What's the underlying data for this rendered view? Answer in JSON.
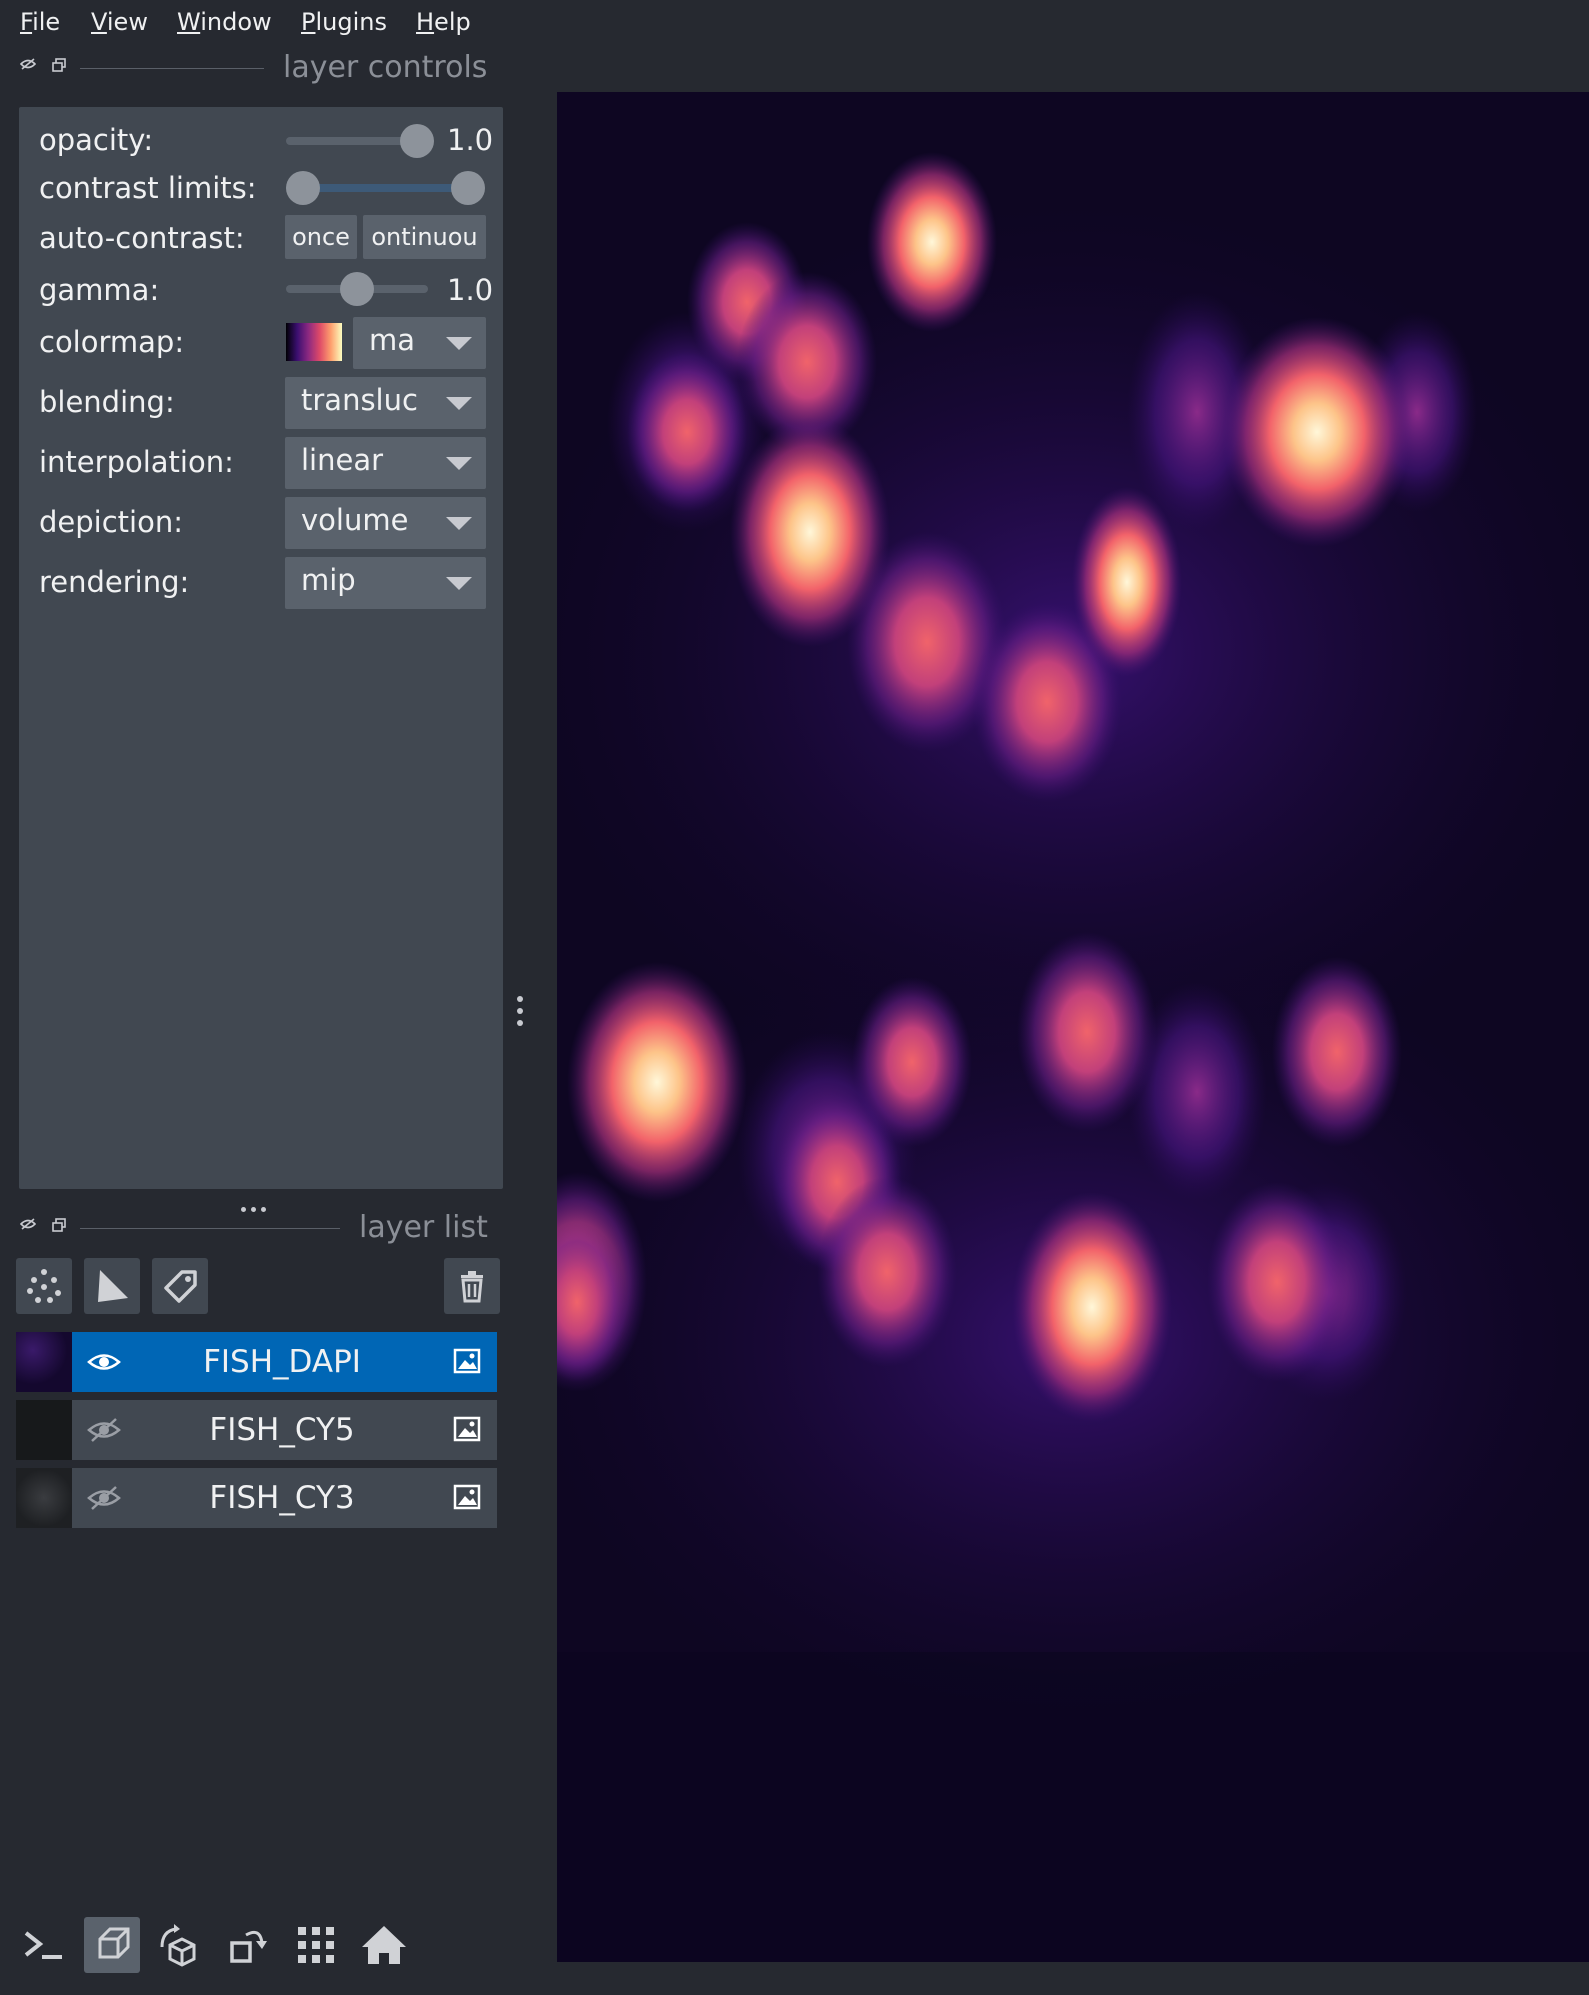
{
  "menu": [
    "File",
    "View",
    "Window",
    "Plugins",
    "Help"
  ],
  "controls_header": {
    "title": "layer controls"
  },
  "controls": {
    "opacity": {
      "label": "opacity:",
      "value": "1.0",
      "level": 1.0
    },
    "contrast_limits": {
      "label": "contrast limits:",
      "low": 0.0,
      "high": 1.0
    },
    "auto_contrast": {
      "label": "auto-contrast:",
      "once": "once",
      "continuous": "ontinuou"
    },
    "gamma": {
      "label": "gamma:",
      "value": "1.0",
      "level": 0.5
    },
    "colormap": {
      "label": "colormap:",
      "value": "ma"
    },
    "blending": {
      "label": "blending:",
      "value": "transluc"
    },
    "interpolation": {
      "label": "interpolation:",
      "value": "linear"
    },
    "depiction": {
      "label": "depiction:",
      "value": "volume"
    },
    "rendering": {
      "label": "rendering:",
      "value": "mip"
    }
  },
  "layerlist_header": {
    "title": "layer list"
  },
  "layers": [
    {
      "name": "FISH_DAPI",
      "selected": true,
      "visible": true
    },
    {
      "name": "FISH_CY5",
      "selected": false,
      "visible": false
    },
    {
      "name": "FISH_CY3",
      "selected": false,
      "visible": false
    }
  ],
  "colors": {
    "background": "#262930",
    "panel": "#414851",
    "selection": "#0066b5",
    "colormap": "magma"
  }
}
